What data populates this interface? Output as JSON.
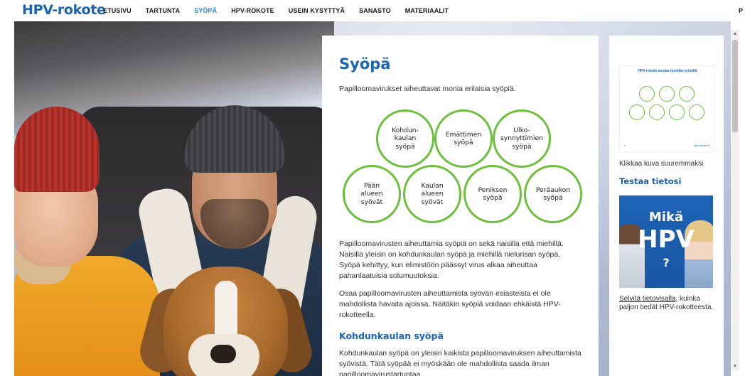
{
  "header": {
    "logo": "HPV-rokote",
    "nav": [
      "ETUSIVU",
      "TARTUNTA",
      "SYÖPÄ",
      "HPV-ROKOTE",
      "USEIN KYSYTTYÄ",
      "SANASTO",
      "MATERIAALIT"
    ],
    "active": "SYÖPÄ",
    "truncated_item": "P"
  },
  "main": {
    "title": "Syöpä",
    "intro": "Papilloomavirukset aiheuttavat monia erilaisia syöpiä.",
    "circles": [
      "Kohdun-\nkaulan\nsyöpä",
      "Emättimen\nsyöpä",
      "Ulko-\nsynnyttimien\nsyöpä",
      "Pään\nalueen\nsyövät",
      "Kaulan\nalueen\nsyövät",
      "Peniksen\nsyöpä",
      "Peräaukon\nsyöpä"
    ],
    "para1": "Papilloomavirusten aiheuttamia syöpiä on sekä naisilla että miehillä. Naisilla yleisin on kohdunkaulan syöpä ja miehillä nielurisan syöpä. Syöpä kehittyy, kun elimistöön päässyt virus alkaa aiheuttaa pahanlaatuisia solumuutoksia.",
    "para2": "Osaa papilloomavirusten aiheuttamista syövän esiasteista ei ole mahdollista havaita ajoissa. Näitäkin syöpiä voidaan ehkäistä HPV-rokotteella.",
    "subtitle": "Kohdunkaulan syöpä",
    "para3": "Kohdunkaulan syöpä on yleisin kaikista papilloomaviruksen aiheuttamista syövistä. Tätä syöpää ei myöskään ole mahdollista saada ilman papilloomavirustartuntaa."
  },
  "side": {
    "thumb_title": "HPV-rokote suojaa monilta syöviltä",
    "thumb_foot_right": "hpv-rokote.fi",
    "caption": "Klikkaa kuva suuremmaksi",
    "quiz_title": "Testaa tietosi",
    "quiz_line1": "Mikä",
    "quiz_line2": "HPV",
    "quiz_line3": "?",
    "link_text": "Selvitä tietovisalla",
    "link_rest": ", kuinka paljon tiedät HPV-rokotteesta."
  },
  "colors": {
    "brand_blue": "#1a64b4",
    "nav_active": "#2f86d4",
    "circle_green": "#6cbf3a"
  },
  "icons": {
    "scroll_up": "▲",
    "scroll_down": "▼"
  }
}
